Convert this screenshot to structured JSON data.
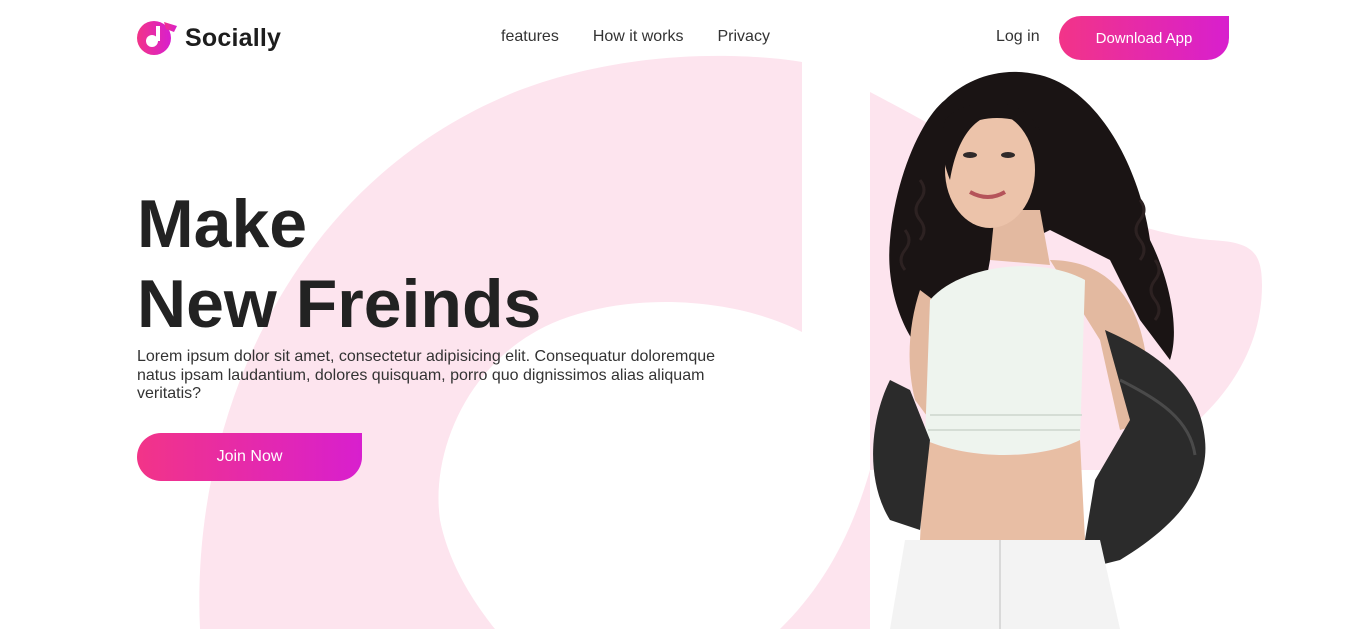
{
  "brand": {
    "name": "Socially",
    "logo_icon": "music-note-bubble-icon"
  },
  "nav": {
    "items": [
      "features",
      "How it works",
      "Privacy"
    ]
  },
  "header": {
    "login_label": "Log in",
    "download_label": "Download App"
  },
  "hero": {
    "title_line1": "Make",
    "title_line2": "New Freinds",
    "description": "Lorem ipsum dolor sit amet, consectetur adipisicing elit. Consequatur doloremque natus ipsam laudantium, dolores quisquam, porro quo dignissimos alias aliquam veritatis?",
    "cta_label": "Join Now",
    "image": "woman-portrait-image"
  },
  "colors": {
    "accent_start": "#f23488",
    "accent_end": "#d81fce",
    "bg_shape": "#fde4ee",
    "text": "#222222"
  }
}
